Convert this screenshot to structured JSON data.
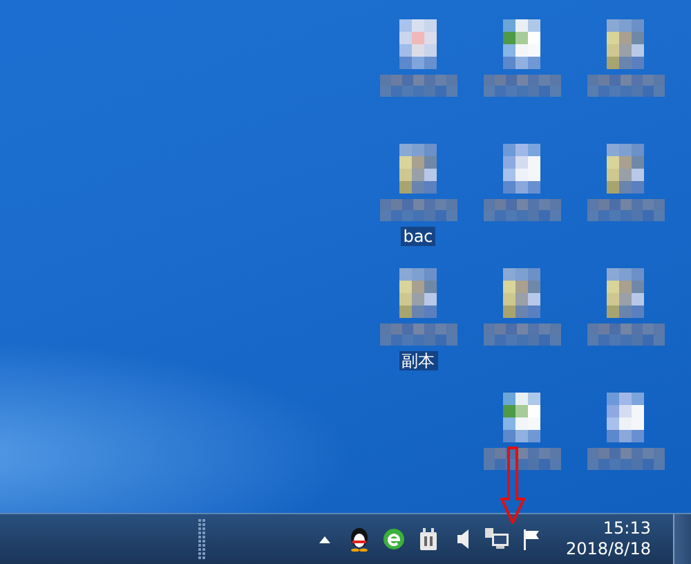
{
  "desktop": {
    "rows": [
      [
        {
          "kind": "document"
        },
        {
          "kind": "sheet"
        },
        {
          "kind": "folder"
        }
      ],
      [
        {
          "kind": "folder",
          "caption": "bac"
        },
        {
          "kind": "image"
        },
        {
          "kind": "folder"
        }
      ],
      [
        {
          "kind": "folder",
          "caption": "副本"
        },
        {
          "kind": "folder"
        },
        {
          "kind": "folder"
        }
      ],
      [
        {
          "kind": "sheet"
        },
        {
          "kind": "image"
        }
      ]
    ]
  },
  "taskbar": {
    "tray": [
      {
        "kind": "up"
      },
      {
        "kind": "penguin"
      },
      {
        "kind": "e"
      },
      {
        "kind": "plug"
      },
      {
        "kind": "speaker"
      },
      {
        "kind": "network"
      },
      {
        "kind": "flag"
      }
    ],
    "time": "15:13",
    "date": "2018/8/18"
  },
  "annotation": {
    "kind": "down-arrow"
  }
}
